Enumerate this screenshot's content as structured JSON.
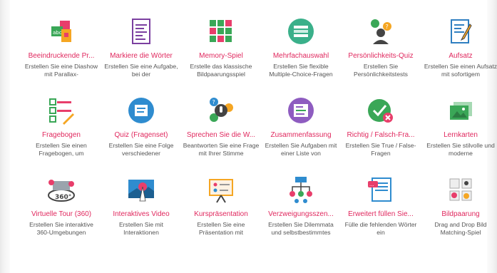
{
  "content_types": [
    {
      "title": "Beeindruckende Pr...",
      "desc": "Erstellen Sie eine Diashow mit Parallax-",
      "icon": "slideshow-icon"
    },
    {
      "title": "Markiere die Wörter",
      "desc": "Erstellen Sie eine Aufgabe, bei der",
      "icon": "mark-words-icon"
    },
    {
      "title": "Memory-Spiel",
      "desc": "Erstelle das klassische Bildpaarungsspiel",
      "icon": "memory-game-icon"
    },
    {
      "title": "Mehrfachauswahl",
      "desc": "Erstellen Sie flexible Multiple-Choice-Fragen",
      "icon": "multiple-choice-icon"
    },
    {
      "title": "Persönlichkeits-Quiz",
      "desc": "Erstellen Sie Persönlichkeitstests",
      "icon": "personality-quiz-icon"
    },
    {
      "title": "Aufsatz",
      "desc": "Erstellen Sie einen Aufsatz mit sofortigem",
      "icon": "essay-icon"
    },
    {
      "title": "Fragebogen",
      "desc": "Erstellen Sie einen Fragebogen, um",
      "icon": "questionnaire-icon"
    },
    {
      "title": "Quiz (Fragenset)",
      "desc": "Erstellen Sie eine Folge verschiedener",
      "icon": "question-set-icon"
    },
    {
      "title": "Sprechen Sie die W...",
      "desc": "Beantworten Sie eine Frage mit Ihrer Stimme",
      "icon": "speak-words-icon"
    },
    {
      "title": "Zusammenfassung",
      "desc": "Erstellen Sie Aufgaben mit einer Liste von",
      "icon": "summary-icon"
    },
    {
      "title": "Richtig / Falsch-Fra...",
      "desc": "Erstellen Sie True / False-Fragen",
      "icon": "true-false-icon"
    },
    {
      "title": "Lernkarten",
      "desc": "Erstellen Sie stilvolle und moderne",
      "icon": "flashcards-icon"
    },
    {
      "title": "Virtuelle Tour (360)",
      "desc": "Erstellen Sie interaktive 360-Umgebungen",
      "icon": "virtual-tour-icon"
    },
    {
      "title": "Interaktives Video",
      "desc": "Erstellen Sie mit Interaktionen",
      "icon": "interactive-video-icon"
    },
    {
      "title": "Kurspräsentation",
      "desc": "Erstellen Sie eine Präsentation mit",
      "icon": "course-presentation-icon"
    },
    {
      "title": "Verzweigungsszen...",
      "desc": "Erstellen Sie Dilemmata und selbstbestimmtes",
      "icon": "branching-scenario-icon"
    },
    {
      "title": "Erweitert füllen Sie...",
      "desc": "Fülle die fehlenden Wörter ein",
      "icon": "advanced-fill-blanks-icon"
    },
    {
      "title": "Bildpaarung",
      "desc": "Drag and Drop Bild Matching-Spiel",
      "icon": "image-pairing-icon"
    }
  ]
}
